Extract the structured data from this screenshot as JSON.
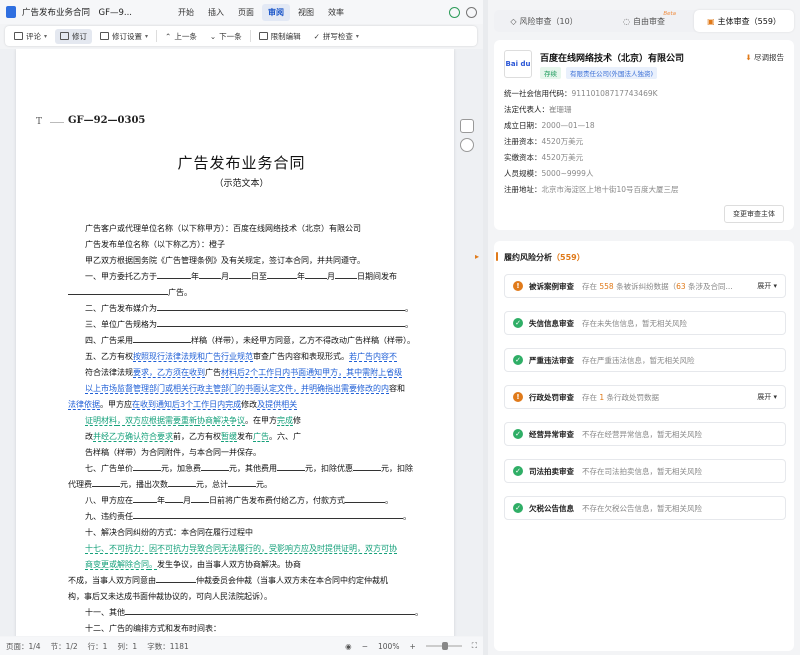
{
  "titlebar": {
    "doc_title": "广告发布业务合同　GF—9...",
    "menus": [
      "开始",
      "插入",
      "页面",
      "审阅",
      "视图",
      "效率"
    ],
    "active_menu": "审阅"
  },
  "toolbar": {
    "items": [
      {
        "label": "评论",
        "icon": "comment-icon",
        "caret": true
      },
      {
        "label": "修订",
        "icon": "track-icon",
        "selected": true
      },
      {
        "label": "修订设置",
        "icon": "settings-icon",
        "caret": true
      },
      {
        "label": "上一条",
        "icon": "up-icon"
      },
      {
        "label": "下一条",
        "icon": "down-icon"
      },
      {
        "label": "限制编辑",
        "icon": "lock-icon"
      },
      {
        "label": "拼写检查",
        "icon": "spell-icon",
        "caret": true
      }
    ]
  },
  "document": {
    "code": "GF—92—0305",
    "title": "广告发布业务合同",
    "subtitle": "（示范文本）",
    "lines": [
      "广告客户或代理单位名称（以下称甲方）：百度在线网络技术（北京）有限公司",
      "广告发布单位名称（以下称乙方）：橙子",
      "甲乙双方根据国务院《广告管理条例》及有关规定，签订本合同，并共同遵守。",
      "一、甲方委托乙方于",
      "年",
      "月",
      "日至",
      "年",
      "月",
      "日期间发布",
      "广告。",
      "二、广告发布媒介为",
      "三、单位广告规格为",
      "四、广告采用",
      "样稿（样带），未经甲方同意，乙方不得改动广告样稿（样带）。",
      "五、乙方有权",
      "按照现行法律法规和广告行业规范",
      "审查广告内容和表现形式。",
      "若广告内容不",
      "符合法律法规",
      "要求，乙方须在收到",
      "广告",
      "材料后2个工作日",
      "内书面通知甲方，其中需附上省级",
      "以上市场监督管理部门或相关行政主管部门的书面认定文件，并明确指出需要修改的内",
      "容和",
      "法律依据",
      "。甲方应",
      "在收到通知后3个工作日内完成",
      "修改",
      "及提供相关",
      "证明材料",
      "，双方应根据需要",
      "重新",
      "协商解决争议",
      "。在甲方",
      "完成",
      "修",
      "改",
      "并经乙方确认符合要求",
      "前，乙方有权",
      "暂缓",
      "发布",
      "广告",
      "。六、广",
      "告样稿（样带）为合同附件，与本合同一并保存。",
      "七、广告单价",
      "元，加急费",
      "元，其他费用",
      "元，扣除优惠",
      "元，扣除",
      "代理费",
      "元，播出次数",
      "元，总计",
      "元。",
      "八、甲方应在",
      "年",
      "月",
      "日前将广告发布费付给乙方，付款方式",
      "九、违约责任",
      "十、解决合同纠纷的方式：本合同在履行过程中",
      "十七、不可抗力：因不可抗力导致合同无法履行的，受影响方应及时提供证明，双方可协",
      "商变更或解除合同",
      "。",
      "发生争议，由当事人双方协商解决。协商",
      "不成，当事人双方同意由",
      "仲裁委员会仲裁（当事人双方未在本合同中约定仲裁机",
      "构，事后又未达成书面仲裁协议的，可向人民法院起诉）。",
      "十一、其他",
      "十二、广告的编排方式和发布时间表："
    ]
  },
  "statusbar": {
    "page": "页面：1/4",
    "section": "节：1/2",
    "row": "行：1",
    "col": "列：1",
    "words": "字数：1181",
    "zoom": "100%"
  },
  "panel": {
    "tabs": [
      {
        "label": "风险审查（10）",
        "icon": "shield-icon"
      },
      {
        "label": "自由审查",
        "icon": "chat-icon",
        "badge": "Beta"
      },
      {
        "label": "主体审查（559）",
        "icon": "building-icon",
        "active": true
      }
    ],
    "company": {
      "logo": "Bai du",
      "name": "百度在线网络技术（北京）有限公司",
      "status": "存续",
      "type": "有限责任公司(外国法人独资)",
      "report": "尽调报告",
      "fields": [
        {
          "k": "统一社会信用代码：",
          "v": "911101087177434​69K"
        },
        {
          "k": "法定代表人：",
          "v": "崔珊珊"
        },
        {
          "k": "成立日期：",
          "v": "2000—01—18"
        },
        {
          "k": "注册资本：",
          "v": "4520万美元"
        },
        {
          "k": "实缴资本：",
          "v": "4520万美元"
        },
        {
          "k": "人员规模：",
          "v": "5000~9999人"
        },
        {
          "k": "注册地址：",
          "v": "北京市海淀区上地十街10号百度大厦三层"
        }
      ],
      "change_btn": "变更审查主体"
    },
    "risk": {
      "title": "履约风险分析",
      "count": "（559）",
      "items": [
        {
          "status": "warn",
          "name": "被诉案例审查",
          "pre": "存在 ",
          "n1": "558",
          "mid": " 条被诉纠纷数据（",
          "n2": "63",
          "post": " 条涉及合同...",
          "expand": "展开"
        },
        {
          "status": "ok",
          "name": "失信信息审查",
          "desc": "存在未失信信息，暂无相关风险"
        },
        {
          "status": "ok",
          "name": "严重违法审查",
          "desc": "存在严重违法信息，暂无相关风险"
        },
        {
          "status": "warn",
          "name": "行政处罚审查",
          "pre": "存在 ",
          "n1": "1",
          "mid": " 条行政处罚数据",
          "n2": "",
          "post": "",
          "expand": "展开"
        },
        {
          "status": "ok",
          "name": "经营异常审查",
          "desc": "不存在经营异常信息，暂无相关风险"
        },
        {
          "status": "ok",
          "name": "司法拍卖审查",
          "desc": "不存在司法拍卖信息，暂无相关风险"
        },
        {
          "status": "ok",
          "name": "欠税公告信息",
          "desc": "不存在欠税公告信息，暂无相关风险"
        }
      ]
    }
  },
  "colors": {
    "accent": "#1a55c8",
    "warn": "#e07a1a",
    "ok": "#2fae66",
    "track_blue": "#1f5fd6",
    "track_green": "#14a07a"
  }
}
